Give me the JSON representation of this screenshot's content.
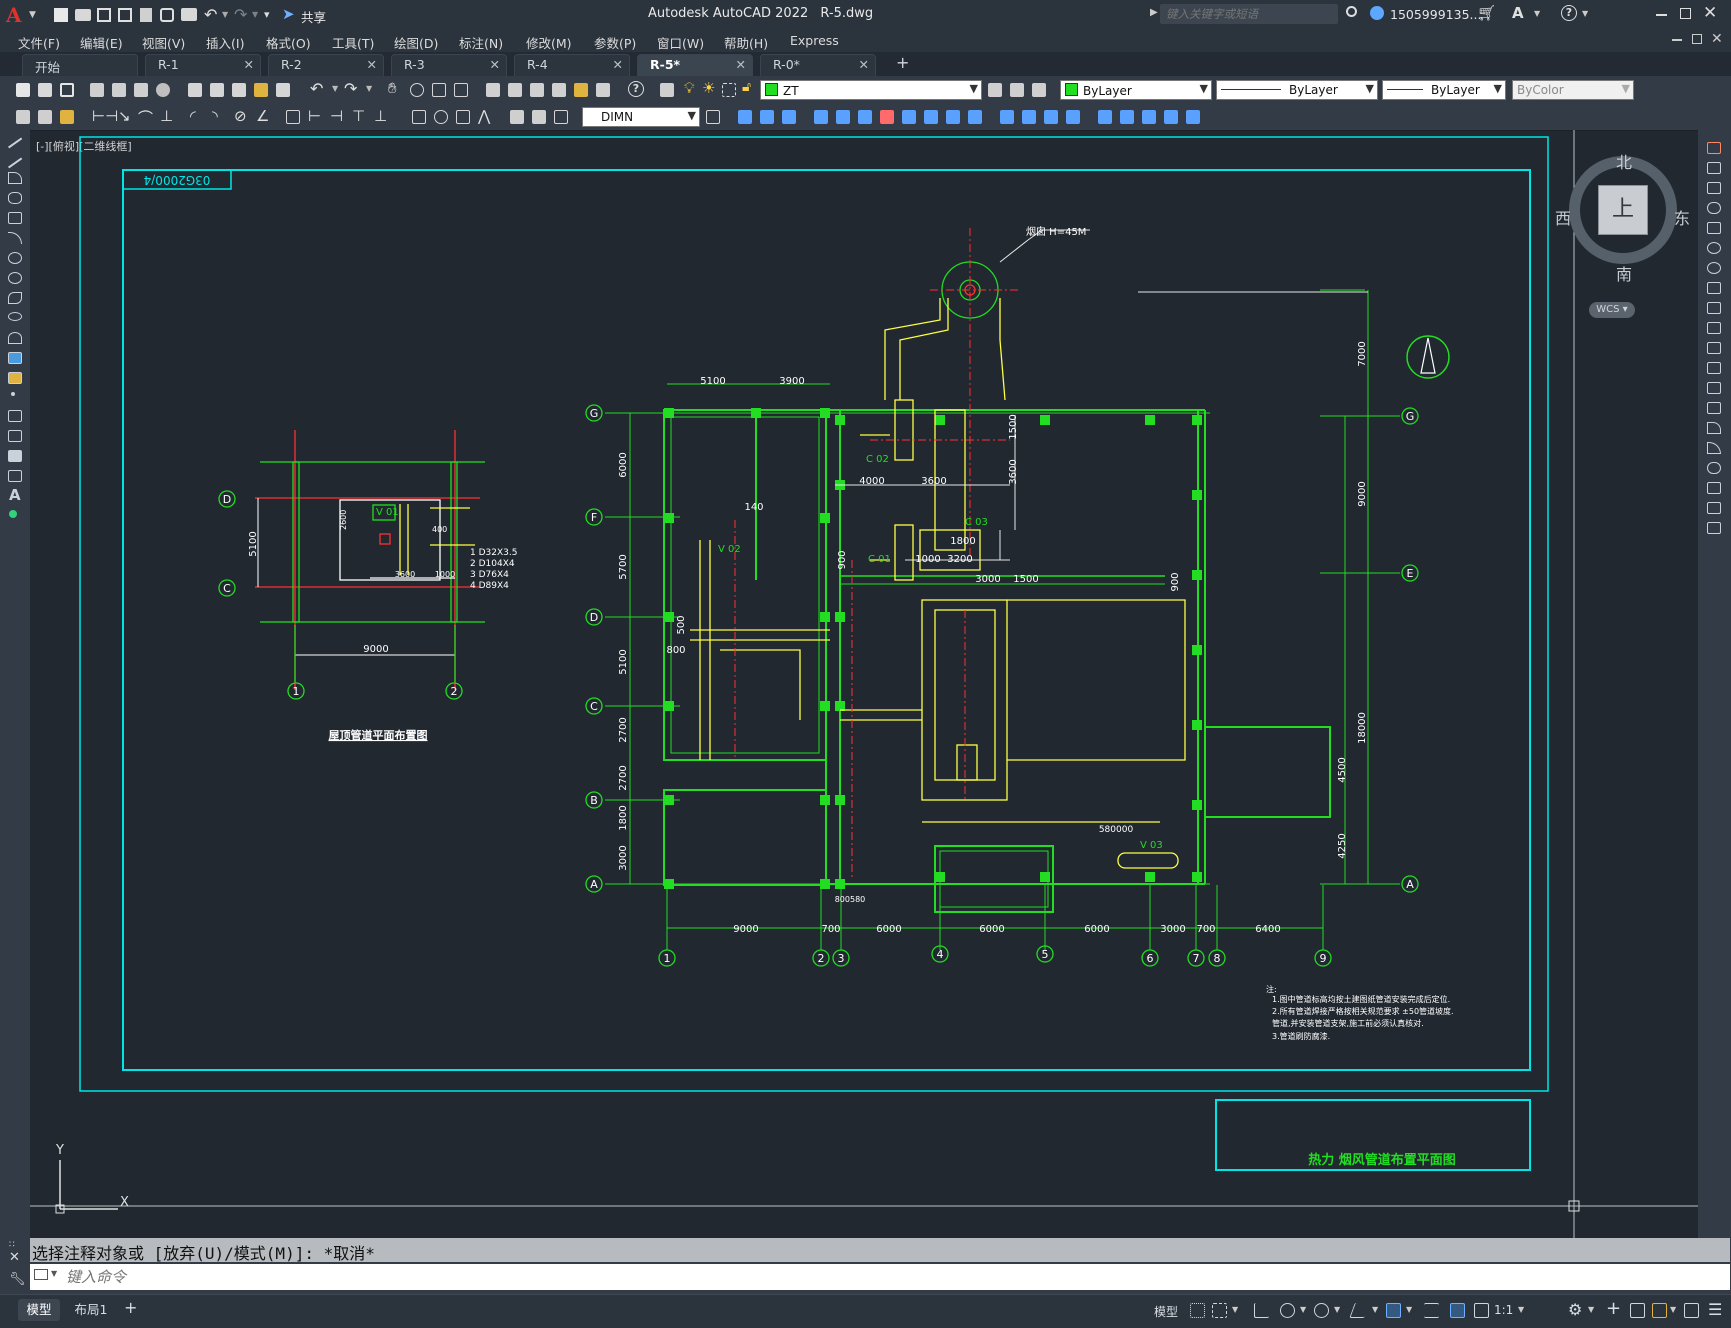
{
  "app": {
    "title": "Autodesk AutoCAD 2022",
    "file": "R-5.dwg",
    "share_label": "共享",
    "search_placeholder": "键入关键字或短语",
    "user": "1505999135...",
    "logo": "A"
  },
  "menu": [
    "文件(F)",
    "编辑(E)",
    "视图(V)",
    "插入(I)",
    "格式(O)",
    "工具(T)",
    "绘图(D)",
    "标注(N)",
    "修改(M)",
    "参数(P)",
    "窗口(W)",
    "帮助(H)",
    "Express"
  ],
  "tabs": [
    {
      "label": "开始",
      "closable": false,
      "active": false
    },
    {
      "label": "R-1",
      "closable": true,
      "active": false
    },
    {
      "label": "R-2",
      "closable": true,
      "active": false
    },
    {
      "label": "R-3",
      "closable": true,
      "active": false
    },
    {
      "label": "R-4",
      "closable": true,
      "active": false
    },
    {
      "label": "R-5*",
      "closable": true,
      "active": true
    },
    {
      "label": "R-0*",
      "closable": true,
      "active": false
    }
  ],
  "toolbar": {
    "layer": "ZT",
    "color": "ByLayer",
    "linetype": "ByLayer",
    "lineweight": "ByLayer",
    "plotstyle": "ByColor",
    "dimstyle": "DIMN"
  },
  "viewport_label": "[-][俯视][二维线框]",
  "viewcube": {
    "north": "北",
    "south": "南",
    "east": "东",
    "west": "西",
    "top": "上",
    "wcs": "WCS"
  },
  "drawing": {
    "frame_code": "03G2000/4",
    "main_title": "热力  烟风管道布置平面图",
    "small_plan_title": "屋顶管道平面布置图",
    "chimney_label": "烟囱 H=45M",
    "notes": [
      "注:",
      "1.图中管道标高均按土建图纸管道安装完成后定位.",
      "2.所有管道焊接严格按相关规范要求 ±50管道坡度.",
      "  管道,并安装管道支架,施工前必须认真核对.",
      "3.管道刷防腐漆."
    ],
    "axes_rows": [
      "G",
      "F",
      "D",
      "C",
      "B",
      "A"
    ],
    "axes_cols": [
      "1",
      "2",
      "3",
      "4",
      "5",
      "6",
      "7",
      "8",
      "9"
    ],
    "right_rows": [
      "G",
      "E",
      "A"
    ],
    "small_rows": [
      "D",
      "C"
    ],
    "small_cols": [
      "1",
      "2"
    ],
    "dims_top": [
      "5100",
      "3900"
    ],
    "dims_bottom": [
      "9000",
      "700",
      "6000",
      "6000",
      "6000",
      "3000",
      "700",
      "6400"
    ],
    "dims_left": [
      "6000",
      "5700",
      "5100",
      "2700",
      "2700",
      "1800",
      "3000"
    ],
    "dims_right": [
      "7000",
      "9000",
      "18000",
      "4500",
      "4250"
    ],
    "dims_misc": [
      "4000",
      "3600",
      "1500",
      "3600",
      "1800",
      "1000",
      "3200",
      "3000",
      "1500",
      "900",
      "140",
      "900",
      "800",
      "500",
      "800580",
      "580000"
    ],
    "small_dims": [
      "9000",
      "5100",
      "2600",
      "3600",
      "1000",
      "400"
    ],
    "small_labels": [
      "1 D32X3.5",
      "2 D104X4",
      "3 D76X4",
      "4 D89X4"
    ],
    "equipment": [
      "C 01",
      "C 02",
      "C 03",
      "V 01",
      "V 02",
      "V 03"
    ]
  },
  "command": {
    "history": "选择注释对象或 [放弃(U)/模式(M)]: *取消*",
    "placeholder": "键入命令"
  },
  "status": {
    "tabs": [
      "模型",
      "布局1"
    ],
    "model": "模型",
    "scale": "1:1"
  }
}
